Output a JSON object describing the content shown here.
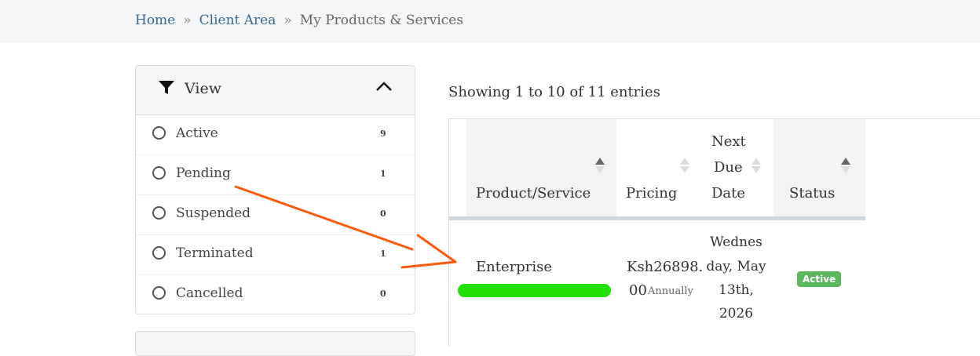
{
  "breadcrumb": {
    "items": [
      "Home",
      "Client Area",
      "My Products & Services"
    ],
    "separator": "»"
  },
  "sidebar": {
    "title": "View",
    "filters": [
      {
        "label": "Active",
        "count": "9"
      },
      {
        "label": "Pending",
        "count": "1"
      },
      {
        "label": "Suspended",
        "count": "0"
      },
      {
        "label": "Terminated",
        "count": "1"
      },
      {
        "label": "Cancelled",
        "count": "0"
      }
    ]
  },
  "main": {
    "entries_text": "Showing 1 to 10 of 11 entries",
    "table": {
      "columns": [
        "Product/Service",
        "Pricing",
        "Next Due Date",
        "Status"
      ],
      "column_lines": {
        "next_due_date": [
          "Next",
          "Due",
          "Date"
        ]
      },
      "rows": [
        {
          "product": "Enterprise",
          "pricing_lines": [
            "Ksh26898.",
            "00"
          ],
          "cycle": "Annually",
          "due_lines": [
            "Wednes",
            "day, May",
            "13th,",
            "2026"
          ],
          "status": "Active"
        }
      ]
    }
  },
  "colors": {
    "annotation_arrow": "#ff5a0a",
    "redaction": "#22e000",
    "active_badge": "#5cb85c",
    "link": "#3a6a93"
  }
}
